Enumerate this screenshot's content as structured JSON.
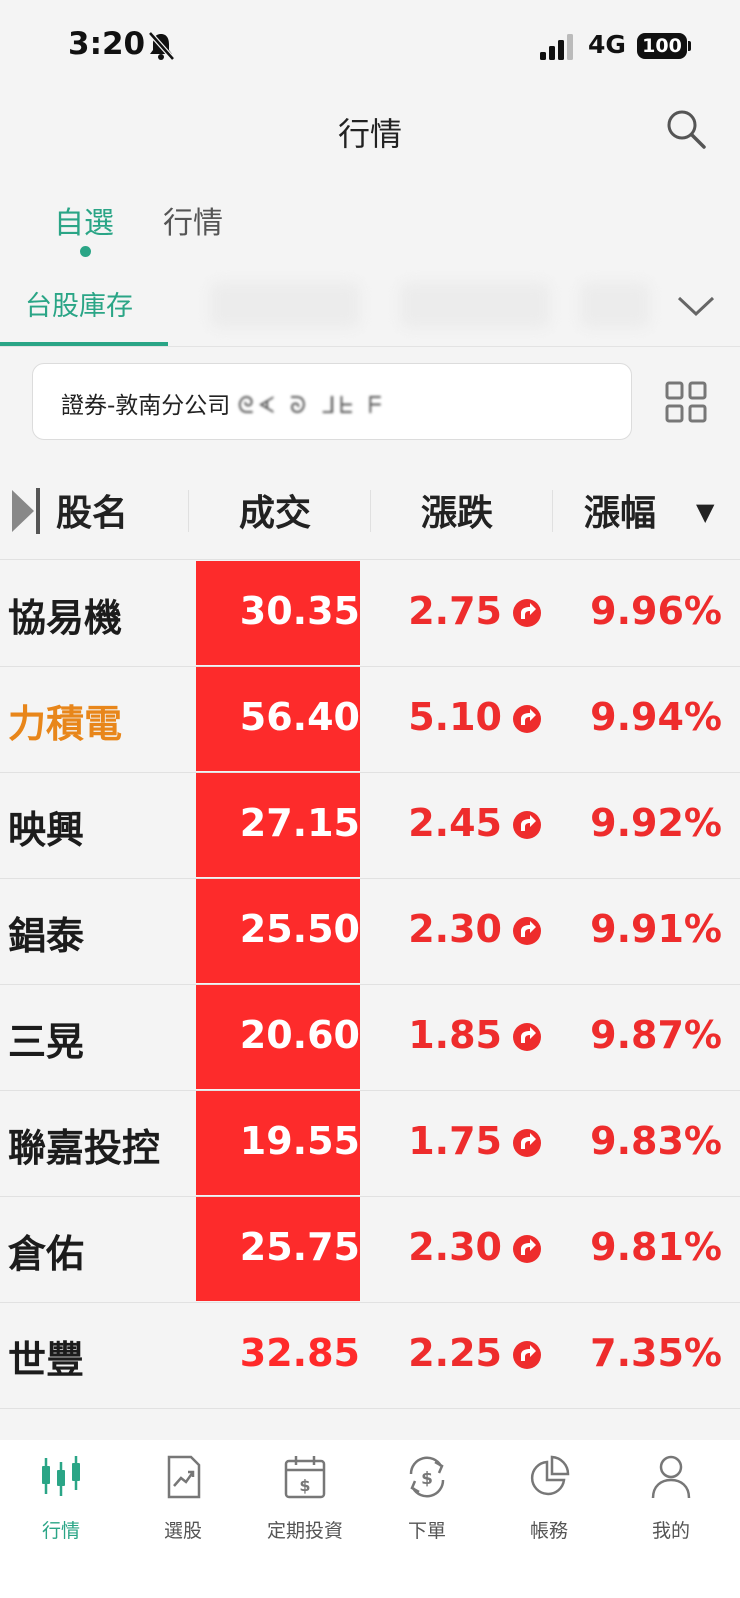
{
  "status_bar": {
    "time": "3:20",
    "network": "4G",
    "battery": "100"
  },
  "header": {
    "title": "行情"
  },
  "primary_tabs": [
    {
      "label": "自選",
      "active": true
    },
    {
      "label": "行情",
      "active": false
    }
  ],
  "secondary_tabs": {
    "active_label": "台股庫存"
  },
  "account": {
    "label": "證券-敦南分公司",
    "masked_number": "ᘓᗉ ᘐ ᒧᖶ ᖴ"
  },
  "table": {
    "headers": {
      "name": "股名",
      "price": "成交",
      "change": "漲跌",
      "pct": "漲幅",
      "sort_indicator": "▼"
    },
    "rows": [
      {
        "name": "協易機",
        "price": "30.35",
        "change": "2.75",
        "pct": "9.96%"
      },
      {
        "name": "力積電",
        "price": "56.40",
        "change": "5.10",
        "pct": "9.94%"
      },
      {
        "name": "映興",
        "price": "27.15",
        "change": "2.45",
        "pct": "9.92%"
      },
      {
        "name": "錩泰",
        "price": "25.50",
        "change": "2.30",
        "pct": "9.91%"
      },
      {
        "name": "三晃",
        "price": "20.60",
        "change": "1.85",
        "pct": "9.87%"
      },
      {
        "name": "聯嘉投控",
        "price": "19.55",
        "change": "1.75",
        "pct": "9.83%"
      },
      {
        "name": "倉佑",
        "price": "25.75",
        "change": "2.30",
        "pct": "9.81%"
      },
      {
        "name": "世豐",
        "price": "32.85",
        "change": "2.25",
        "pct": "7.35%"
      }
    ]
  },
  "bottom_nav": [
    {
      "label": "行情",
      "icon": "candlestick-icon",
      "active": true
    },
    {
      "label": "選股",
      "icon": "stock-picker-icon",
      "active": false
    },
    {
      "label": "定期投資",
      "icon": "calendar-invest-icon",
      "active": false
    },
    {
      "label": "下單",
      "icon": "order-icon",
      "active": false
    },
    {
      "label": "帳務",
      "icon": "pie-chart-icon",
      "active": false
    },
    {
      "label": "我的",
      "icon": "profile-icon",
      "active": false
    }
  ],
  "colors": {
    "accent": "#2aa586",
    "up_red": "#ee2c2c",
    "limit_up_bg": "#fd2b2b",
    "highlight_orange": "#e8861a"
  }
}
